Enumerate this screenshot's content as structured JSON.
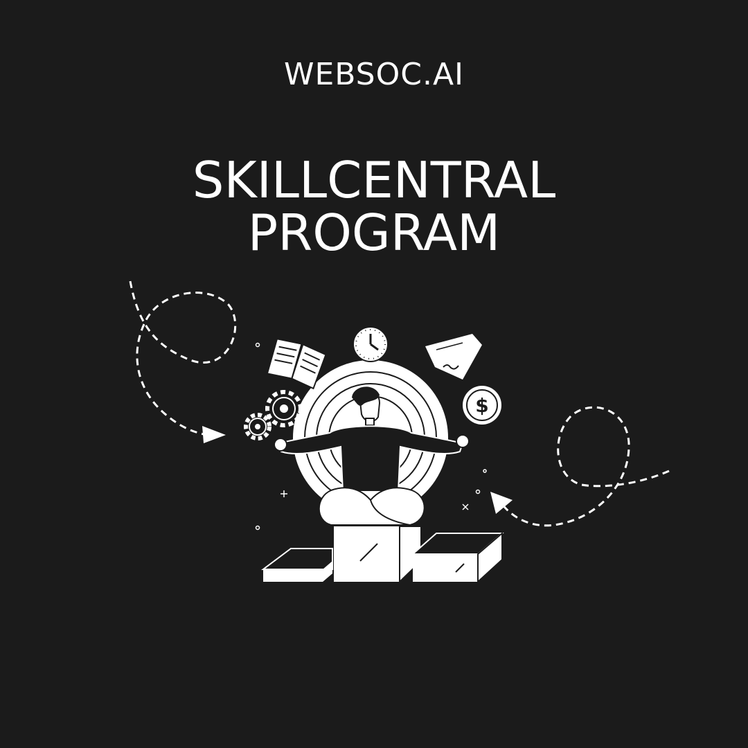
{
  "brand": "WEBSOC.AI",
  "title": {
    "line1": "SKILLCENTRAL",
    "line2": "PROGRAM"
  },
  "illustration": {
    "dollar_symbol": "$",
    "icons": [
      "open-book-icon",
      "clock-icon",
      "document-icon",
      "dollar-coin-icon",
      "gears-icon",
      "meditating-person",
      "podium-icon",
      "dashed-arrow-icon"
    ]
  },
  "colors": {
    "background": "#1b1b1b",
    "foreground": "#ffffff"
  }
}
